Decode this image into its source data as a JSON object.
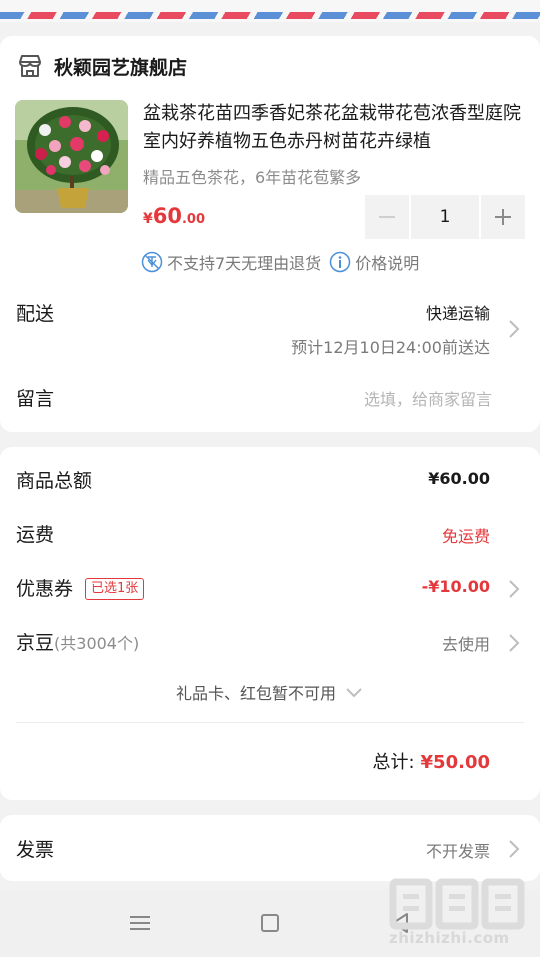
{
  "shop": {
    "name": "秋颖园艺旗舰店",
    "icon": "store-icon"
  },
  "product": {
    "title": "盆栽茶花苗四季香妃茶花盆栽带花苞浓香型庭院室内好养植物五色赤丹树苗花卉绿植",
    "spec": "精品五色茶花，6年苗花苞繁多",
    "price_currency": "¥",
    "price_int": "60",
    "price_dec": ".00",
    "quantity": "1",
    "notice_no_return": "不支持7天无理由退货",
    "notice_price_info": "价格说明"
  },
  "delivery": {
    "label": "配送",
    "method": "快递运输",
    "eta": "预计12月10日24:00前送达"
  },
  "message": {
    "label": "留言",
    "placeholder": "选填，给商家留言"
  },
  "summary": {
    "goods_total_label": "商品总额",
    "goods_total_value": "¥60.00",
    "shipping_label": "运费",
    "shipping_value": "免运费",
    "coupon_label": "优惠券",
    "coupon_tag": "已选1张",
    "coupon_value": "-¥10.00",
    "beans_label": "京豆",
    "beans_count": "(共3004个)",
    "beans_action": "去使用",
    "giftcard_note": "礼品卡、红包暂不可用",
    "total_label": "总计:",
    "total_value": "¥50.00"
  },
  "invoice": {
    "label": "发票",
    "value": "不开发票"
  },
  "watermark": {
    "text": "zhizhizhi.com"
  },
  "colors": {
    "accent": "#e4393c",
    "muted": "#8c8c8c",
    "text": "#1a1a1a"
  }
}
